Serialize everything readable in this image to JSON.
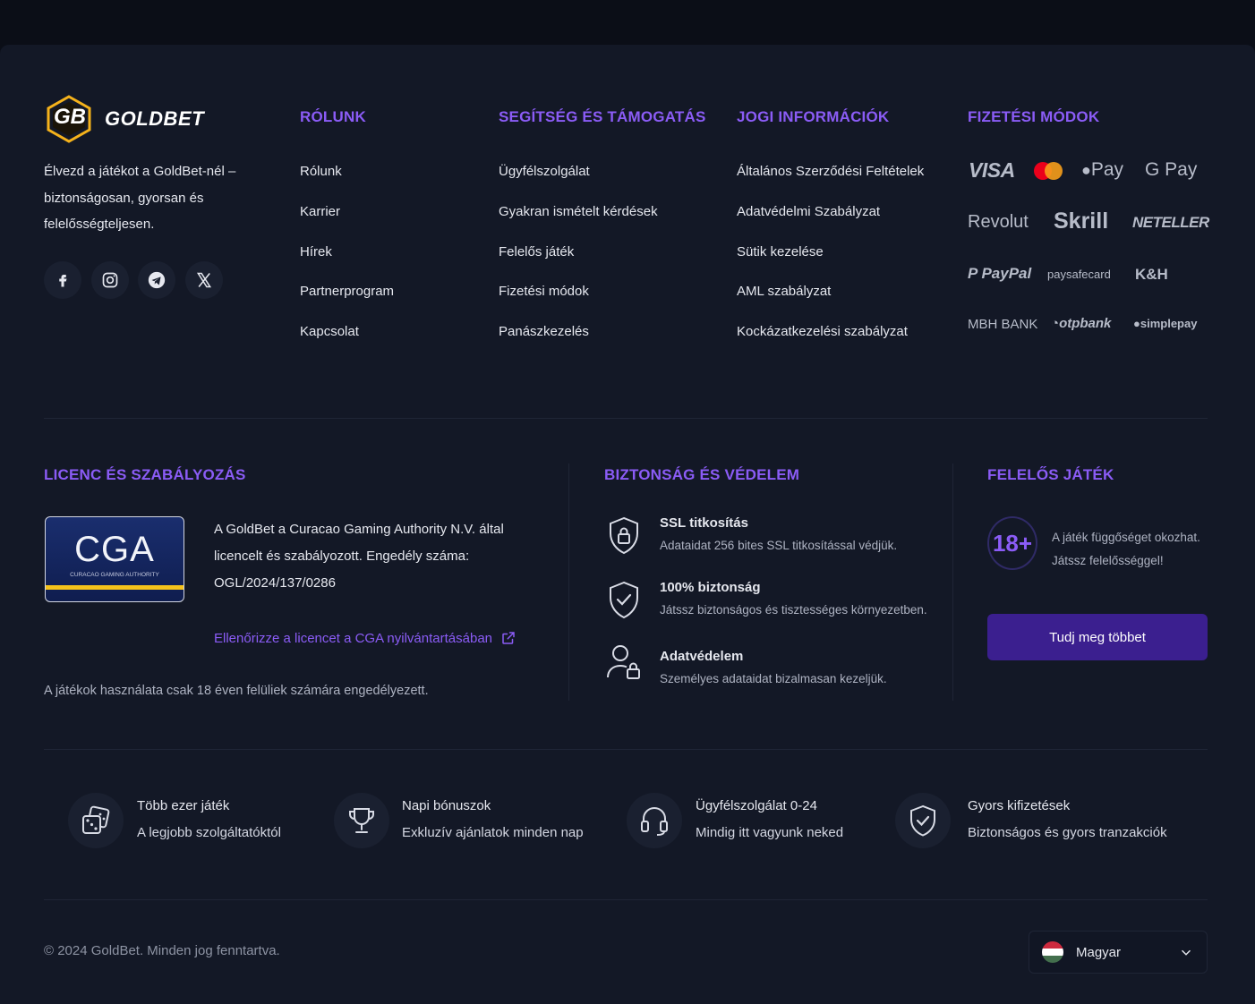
{
  "brand": {
    "logo_text": "GB",
    "name": "GOLDBET",
    "tagline": "Élvezd a játékot a GoldBet-nél – biztonságosan, gyorsan és felelősségteljesen."
  },
  "social": [
    "facebook-icon",
    "instagram-icon",
    "telegram-icon",
    "x-icon"
  ],
  "columns": [
    {
      "title": "RÓLUNK",
      "items": [
        "Rólunk",
        "Karrier",
        "Hírek",
        "Partnerprogram",
        "Kapcsolat"
      ]
    },
    {
      "title": "SEGÍTSÉG ÉS TÁMOGATÁS",
      "items": [
        "Ügyfélszolgálat",
        "Gyakran ismételt kérdések",
        "Felelős játék",
        "Fizetési módok",
        "Panászkezelés"
      ]
    },
    {
      "title": "JOGI INFORMÁCIÓK",
      "items": [
        "Általános Szerződési Feltételek",
        "Adatvédelmi Szabályzat",
        "Sütik kezelése",
        "AML szabályzat",
        "Kockázatkezelési szabályzat"
      ]
    }
  ],
  "payments": {
    "title": "FIZETÉSI MÓDOK",
    "methods": [
      "VISA",
      "Mastercard",
      "Pay",
      "G Pay",
      "Revolut",
      "Skrill",
      "NETELLER",
      "PayPal",
      "paysafecard",
      "K&H",
      "MBH BANK",
      "otpbank",
      "simplepay"
    ]
  },
  "license": {
    "title": "LICENC ÉS SZABÁLYOZÁS",
    "badge": "CGA",
    "badge_sub": "CURACAO GAMING AUTHORITY",
    "text": "A GoldBet a Curacao Gaming Authority N.V. által licencelt és szabályozott. Engedély száma:",
    "number": "OGL/2024/137/0286",
    "verify_link": "Ellenőrizze a licencet a CGA nyilvántartásában",
    "age_note": "A játékok használata csak 18 éven felüliek számára engedélyezett."
  },
  "security": {
    "title": "BIZTONSÁG ÉS VÉDELEM",
    "items": [
      {
        "title": "SSL titkosítás",
        "desc": "Adataidat 256 bites SSL titkosítással védjük."
      },
      {
        "title": "100% biztonság",
        "desc": "Játssz biztonságos és tisztességes környezetben."
      },
      {
        "title": "Adatvédelem",
        "desc": "Személyes adataidat bizalmasan kezeljük."
      }
    ]
  },
  "responsible": {
    "title": "FELELŐS JÁTÉK",
    "age": "18+",
    "text": "A játék függőséget okozhat. Játssz felelősséggel!",
    "button": "Tudj meg többet"
  },
  "features": [
    {
      "title": "Több ezer játék",
      "desc": "A legjobb szolgáltatóktól"
    },
    {
      "title": "Napi bónuszok",
      "desc": "Exkluzív ajánlatok minden nap"
    },
    {
      "title": "Ügyfélszolgálat 0-24",
      "desc": "Mindig itt vagyunk neked"
    },
    {
      "title": "Gyors kifizetések",
      "desc": "Biztonságos és gyors tranzakciók"
    }
  ],
  "bottom": {
    "copyright": "© 2024 GoldBet. Minden jog fenntartva.",
    "language": "Magyar"
  },
  "colors": {
    "accent": "#8b5cf6",
    "button": "#3b1f8f",
    "gold": "#f5b21b"
  }
}
